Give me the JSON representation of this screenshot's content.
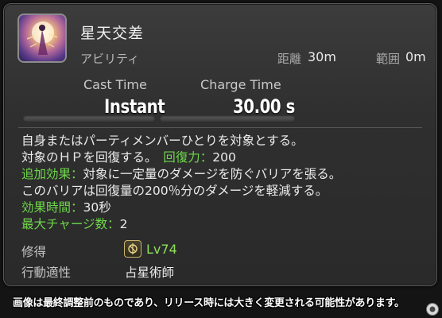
{
  "action": {
    "name": "星天交差",
    "category": "アビリティ",
    "icon": "astrologian-action-icon",
    "range_label": "距離",
    "range_value": "30m",
    "area_label": "範囲",
    "area_value": "0m"
  },
  "timing": {
    "cast_label": "Cast Time",
    "cast_value": "Instant",
    "charge_label": "Charge Time",
    "charge_value": "30.00 s"
  },
  "description": {
    "line1": "自身またはパーティメンバーひとりを対象とする。",
    "line2_text": "対象のＨＰを回復する。　",
    "line2_key": "回復力",
    "line2_sep": "：",
    "line2_value": "200",
    "line3_key": "追加効果",
    "line3_sep": "：",
    "line3_text": "対象に一定量のダメージを防ぐバリアを張る。",
    "line4": "このバリアは回復量の200％分のダメージを軽減する。",
    "line5_key": "効果時間",
    "line5_sep": "：",
    "line5_value": "30秒",
    "line6_key": "最大チャージ数",
    "line6_sep": "：",
    "line6_value": "2"
  },
  "acquisition": {
    "label": "修得",
    "job_icon": "astrologian-job-icon",
    "level": "Lv74"
  },
  "job": {
    "label": "行動適性",
    "value": "占星術師"
  },
  "footer": {
    "disclaimer": "画像は最終調整前のものであり、リリース時には大きく変更される可能性があります。",
    "watermark_icon": "watermark-logo-icon"
  },
  "colors": {
    "highlight_green": "#6fd84a",
    "level_green": "#8ee05a",
    "panel_background": "#2f2f2f"
  }
}
